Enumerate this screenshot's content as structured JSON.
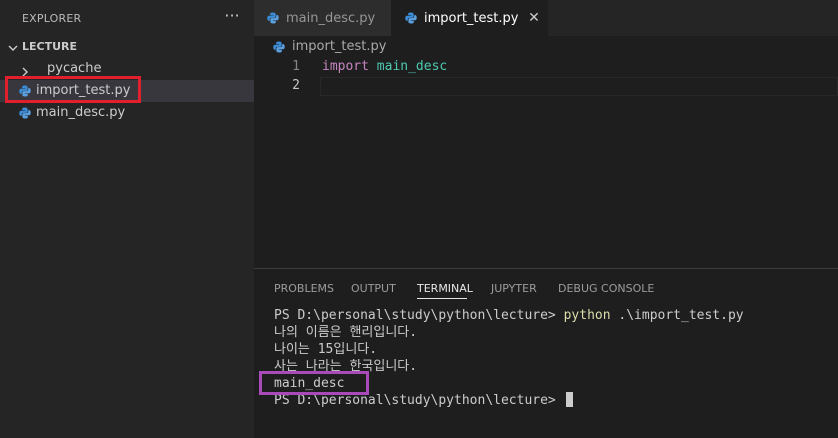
{
  "sidebar": {
    "title": "EXPLORER",
    "more_label": "···",
    "folder": "LECTURE",
    "items": [
      {
        "label": "pycache",
        "type": "folder"
      },
      {
        "label": "import_test.py",
        "type": "python"
      },
      {
        "label": "main_desc.py",
        "type": "python"
      }
    ]
  },
  "tabs": [
    {
      "label": "main_desc.py",
      "active": false
    },
    {
      "label": "import_test.py",
      "active": true
    }
  ],
  "tab_close_label": "✕",
  "breadcrumb": "import_test.py",
  "editor": {
    "lines": [
      {
        "number": "1",
        "keyword": "import",
        "module": "main_desc"
      },
      {
        "number": "2",
        "keyword": "",
        "module": ""
      }
    ]
  },
  "panel": {
    "tabs": [
      "PROBLEMS",
      "OUTPUT",
      "TERMINAL",
      "JUPYTER",
      "DEBUG CONSOLE"
    ],
    "active_tab": "TERMINAL"
  },
  "terminal": {
    "prompt": "PS D:\\personal\\study\\python\\lecture> ",
    "command": "python",
    "args": " .\\import_test.py",
    "output": [
      "나의 이름은 핸리입니다.",
      "나이는 15입니다.",
      "사는 나라는 한국입니다.",
      "main_desc"
    ]
  },
  "colors": {
    "highlight_box_red": "#e0202c",
    "highlight_box_purple": "#a84bb8",
    "python_icon_blue": "#3b8bd6",
    "keyword": "#c586c0",
    "module": "#4ec9b0"
  }
}
